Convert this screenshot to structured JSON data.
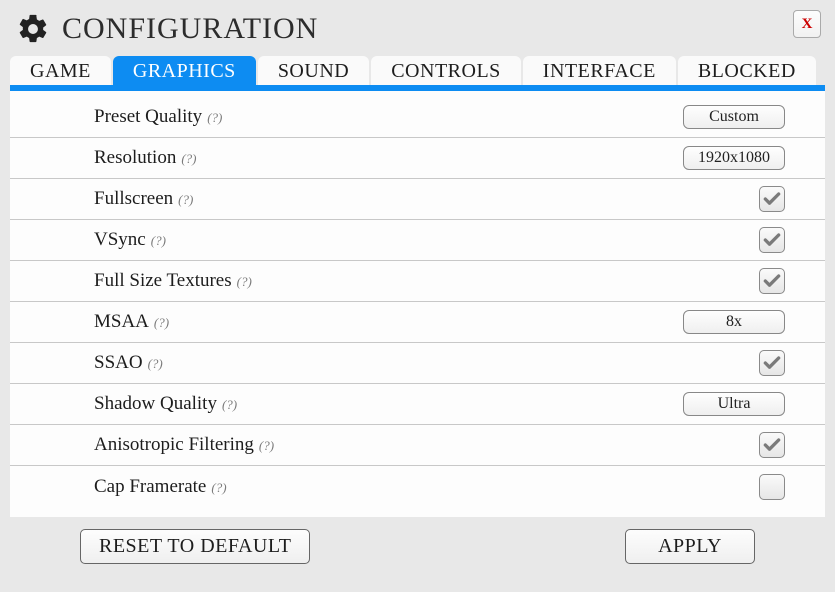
{
  "header": {
    "title": "CONFIGURATION",
    "close": "X"
  },
  "tabs": [
    {
      "label": "GAME",
      "active": false
    },
    {
      "label": "GRAPHICS",
      "active": true
    },
    {
      "label": "SOUND",
      "active": false
    },
    {
      "label": "CONTROLS",
      "active": false
    },
    {
      "label": "INTERFACE",
      "active": false
    },
    {
      "label": "BLOCKED",
      "active": false
    }
  ],
  "settings": [
    {
      "key": "preset-quality",
      "label": "Preset Quality",
      "help": "(?)",
      "type": "select",
      "value": "Custom"
    },
    {
      "key": "resolution",
      "label": "Resolution",
      "help": "(?)",
      "type": "select",
      "value": "1920x1080"
    },
    {
      "key": "fullscreen",
      "label": "Fullscreen",
      "help": "(?)",
      "type": "checkbox",
      "value": true
    },
    {
      "key": "vsync",
      "label": "VSync",
      "help": "(?)",
      "type": "checkbox",
      "value": true
    },
    {
      "key": "full-size-textures",
      "label": "Full Size Textures",
      "help": "(?)",
      "type": "checkbox",
      "value": true
    },
    {
      "key": "msaa",
      "label": "MSAA",
      "help": "(?)",
      "type": "select",
      "value": "8x"
    },
    {
      "key": "ssao",
      "label": "SSAO",
      "help": "(?)",
      "type": "checkbox",
      "value": true
    },
    {
      "key": "shadow-quality",
      "label": "Shadow Quality",
      "help": "(?)",
      "type": "select",
      "value": "Ultra"
    },
    {
      "key": "anisotropic-filtering",
      "label": "Anisotropic Filtering",
      "help": "(?)",
      "type": "checkbox",
      "value": true
    },
    {
      "key": "cap-framerate",
      "label": "Cap Framerate",
      "help": "(?)",
      "type": "checkbox",
      "value": false
    }
  ],
  "footer": {
    "reset": "RESET TO DEFAULT",
    "apply": "APPLY"
  }
}
